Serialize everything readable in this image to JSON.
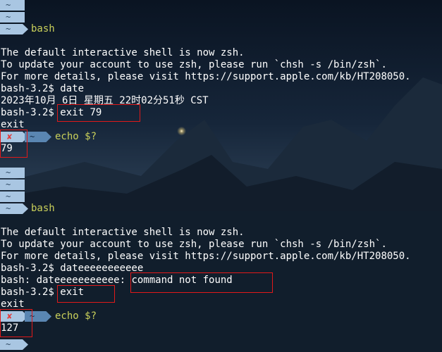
{
  "tilde": "~",
  "error_mark": "✘",
  "prompt_words": {
    "bash": "bash",
    "echo_cmd": "echo $?"
  },
  "block1": {
    "shell_notice": "The default interactive shell is now zsh.",
    "update_line": "To update your account to use zsh, please run `chsh -s /bin/zsh`.",
    "details_line": "For more details, please visit https://support.apple.com/kb/HT208050.",
    "date_cmd": "bash-3.2$ date",
    "date_output": "2023年10月 6日 星期五 22时02分51秒 CST",
    "exit_prompt": "bash-3.2$ ",
    "exit_cmd": "exit 79",
    "exit_echo": "exit",
    "status": "79"
  },
  "block2": {
    "shell_notice": "The default interactive shell is now zsh.",
    "update_line": "To update your account to use zsh, please run `chsh -s /bin/zsh`.",
    "details_line": "For more details, please visit https://support.apple.com/kb/HT208050.",
    "bad_cmd": "bash-3.2$ dateeeeeeeeeee",
    "error_prefix": "bash: dateeeeeeeeeee: ",
    "error_msg": "command not found",
    "exit_prompt": "bash-3.2$ ",
    "exit_cmd": "exit",
    "exit_echo": "exit",
    "status": "127"
  },
  "colors": {
    "prompt_light": "#a9c6e2",
    "prompt_dark": "#5a86b2",
    "command_green": "#c9d05a",
    "error_red": "#e23a3a",
    "highlight_box": "#e11919"
  }
}
